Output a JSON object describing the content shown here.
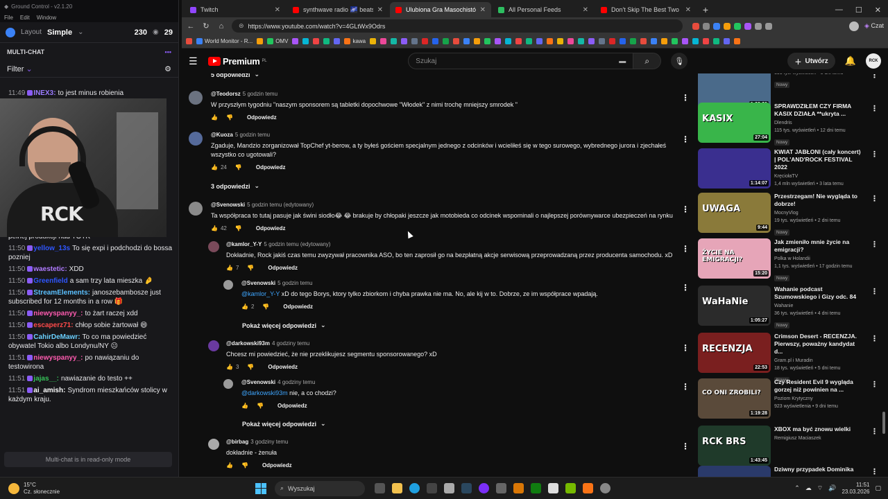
{
  "chat_app": {
    "title": "Ground Control - v2.1.20",
    "menu": [
      "File",
      "Edit",
      "Window"
    ],
    "layout_label": "Layout",
    "layout_value": "Simple",
    "viewers": "230",
    "viewers2": "29",
    "section": "MULTI-CHAT",
    "filter": "Filter",
    "footer": "Multi-chat is in read-only mode",
    "webcam_shirt": "RCK",
    "messages": [
      {
        "time": "11:49",
        "user": "INEX3:",
        "color": "#9b7bff",
        "text": "to jest minus robienia"
      },
      {
        "time": "",
        "user": "",
        "color": "#fff",
        "text": "w open worldy. Już z 4 lata minie od zakończenia pełnej produkcji nad TOTK"
      },
      {
        "time": "11:50",
        "user": "yellow_13s",
        "color": "#2f56ff",
        "text": "To się expi i podchodzi do bossa pozniej"
      },
      {
        "time": "11:50",
        "user": "waestetic:",
        "color": "#b07bff",
        "text": "XDD"
      },
      {
        "time": "11:50",
        "user": "Greenfield",
        "color": "#2f56ff",
        "text": "a sam trzy lata mieszka 🤌"
      },
      {
        "time": "11:50",
        "user": "",
        "color": "#fff",
        "text": "janoszebambosze just subscribed for 12 months in a row 🎁"
      },
      {
        "time": "11:50",
        "user": "StreamElements:",
        "color": "#5bc0ff",
        "text": "janoszebambosze just subscribed for 12 months in a row 🎁"
      },
      {
        "time": "11:50",
        "user": "niewyspanyy_:",
        "color": "#ff5bb0",
        "text": "to żart raczej xdd"
      },
      {
        "time": "11:50",
        "user": "escaperz71:",
        "color": "#ff4a4a",
        "text": "chłop sobie żartował 😄"
      },
      {
        "time": "11:50",
        "user": "CahirDeMawr:",
        "color": "#6ad0ff",
        "text": "To co ma powiedzieć obywatel Tokio albo Londynu/NY 😐"
      },
      {
        "time": "11:51",
        "user": "niewyspanyy_:",
        "color": "#ff5bb0",
        "text": "po nawiązaniu do testowirona"
      },
      {
        "time": "11:51",
        "user": "jajas__:",
        "color": "#37c45a",
        "text": "nawiazanie do testo ++"
      },
      {
        "time": "11:51",
        "user": "ai_amish:",
        "color": "#fff",
        "text": "Syndrom mieszkańców stolicy w każdym kraju."
      }
    ]
  },
  "browser": {
    "tabs": [
      {
        "label": "Twitch",
        "color": "#9146ff"
      },
      {
        "label": "synthwave radio 🌌 beats to",
        "color": "#ff0000"
      },
      {
        "label": "Ulubiona Gra Masochistów - YouTu",
        "color": "#ff0000"
      },
      {
        "label": "All Personal Feeds",
        "color": "#2dbe60"
      },
      {
        "label": "Don't Skip The Best Two Handed W",
        "color": "#ff0000"
      }
    ],
    "url": "https://www.youtube.com/watch?v=4GLtWx9Odrs",
    "profile_label": "Czat",
    "bookmarks": [
      "World Monitor - R...",
      "OMV",
      "kawa"
    ]
  },
  "youtube": {
    "brand": "Premium",
    "brand_sup": "PL",
    "search_placeholder": "Szukaj",
    "create_label": "Utwórz",
    "reply_label": "Odpowiedz",
    "show_more_replies": "Pokaż więcej odpowiedzi",
    "toggles": [
      "5 odpowiedzi",
      "3 odpowiedzi"
    ],
    "comments": [
      {
        "handle": "@Teodorsz",
        "time": "5 godzin temu",
        "text": "W przyszłym tygodniu \"naszym sponsorem są tabletki dopochwowe \"Włodek\" z nimi trochę mniejszy smrodek \"",
        "likes": ""
      },
      {
        "handle": "@Kuoza",
        "time": "5 godzin temu",
        "text": "Zgaduje, Mandzio zorganizował TopChef yt-berow, a ty byłeś gościem specjalnym jednego z odcinków i wcieliłeś się w tego surowego, wybrednego jurora i zjechałeś wszystko co ugotowali?",
        "likes": "24"
      },
      {
        "handle": "@Svenowski",
        "time": "5 godzin temu (edytowany)",
        "text": "Ta współpraca to tutaj pasuje jak świni siodło😂 😂 brakuje by chłopaki jeszcze jak motobieda co odcinek wspominali o najlepszej porównywarce ubezpieczeń na rynku",
        "likes": "42"
      },
      {
        "handle": "@kamlor_Y-Y",
        "time": "5 godzin temu (edytowany)",
        "text": "Dokładnie, Rock jakiś czas temu zwyzywał pracownika ASO, bo ten zaprosił go na bezpłatną akcje serwisową przeprowadzaną przez producenta samochodu. xD",
        "likes": "7"
      },
      {
        "handle": "@Svenowski",
        "time": "5 godzin temu",
        "mention": "@kamlor_Y-Y",
        "text": "xD do tego Borys, ktory tylko zbiorkom i chyba prawka nie ma. No, ale kij w to. Dobrze, ze im współprace wpadają.",
        "likes": "2"
      },
      {
        "handle": "@darkowski93m",
        "time": "4 godziny temu",
        "text": "Chcesz mi powiedzieć, że nie przeklikujesz segmentu sponsorowanego? xD",
        "likes": "3"
      },
      {
        "handle": "@Svenowski",
        "time": "4 godziny temu",
        "mention": "@darkowski93m",
        "text": "nie, a co chodzi?",
        "likes": ""
      },
      {
        "handle": "@birbag",
        "time": "3 godziny temu",
        "text": "dokładnie - żenuła",
        "likes": ""
      }
    ],
    "recommendations": [
      {
        "title": "",
        "channel": "",
        "stats": "193 tys. wyświetleń • 5 dni temu",
        "badge": "Nowy",
        "duration": "1:00:01",
        "thumb": "#4a6a8a",
        "thumb_text": ""
      },
      {
        "title": "SPRAWDZIŁEM CZY FIRMA KASIX DZIAŁA **ukryta ...",
        "channel": "Dlendris",
        "stats": "115 tys. wyświetleń • 12 dni temu",
        "badge": "Nowy",
        "duration": "27:04",
        "thumb": "#39b54a",
        "thumb_text": "KASIX"
      },
      {
        "title": "KWIAT JABŁONI (cały koncert) | POL'AND'ROCK FESTIVAL 2022",
        "channel": "KręciołaTV",
        "stats": "1,4 mln wyświetleń • 3 lata temu",
        "badge": "",
        "duration": "1:14:07",
        "thumb": "#3a2f8f",
        "thumb_text": ""
      },
      {
        "title": "Przestrzegam! Nie wygląda to dobrze!",
        "channel": "MocnyVlog",
        "stats": "19 tys. wyświetleń • 2 dni temu",
        "badge": "Nowy",
        "duration": "9:44",
        "thumb": "#8a7a3a",
        "thumb_text": "UWAGA"
      },
      {
        "title": "Jak zmieniło mnie życie na emigracji?",
        "channel": "Polka w Holandii",
        "stats": "1,1 tys. wyświetleń • 17 godzin temu",
        "badge": "Nowy",
        "duration": "15:20",
        "thumb": "#e6a5b8",
        "thumb_text": "ŻYCIE NA EMIGRACJI?"
      },
      {
        "title": "Wahanie podcast Szumowskiego i Gizy odc. 84",
        "channel": "Wahanie",
        "stats": "36 tys. wyświetleń • 4 dni temu",
        "badge": "Nowy",
        "duration": "1:05:27",
        "thumb": "#2b2b2b",
        "thumb_text": "WaHaNie"
      },
      {
        "title": "Crimson Desert - RECENZJA. Pierwszy, poważny kandydat d...",
        "channel": "Gram.pl i Muradin",
        "stats": "18 tys. wyświetleń • 5 dni temu",
        "badge": "Nowy",
        "duration": "22:53",
        "thumb": "#7a1f1f",
        "thumb_text": "RECENZJA"
      },
      {
        "title": "Czy Resident Evil 9 wygląda gorzej niż powinien na ...",
        "channel": "Poziom Krytyczny",
        "stats": "923 wyświetlenia • 9 dni temu",
        "badge": "",
        "duration": "1:19:28",
        "thumb": "#5a4a3a",
        "thumb_text": "CO ONI ZROBILI?"
      },
      {
        "title": "XBOX ma być znowu wielki",
        "channel": "Remigiusz Maciaszek",
        "stats": "",
        "badge": "",
        "duration": "1:43:45",
        "thumb": "#1f3a2a",
        "thumb_text": "RCK BRS"
      },
      {
        "title": "Dziwny przypadek Dominika",
        "channel": "",
        "stats": "",
        "badge": "",
        "duration": "",
        "thumb": "#2a3a6a",
        "thumb_text": ""
      }
    ]
  },
  "taskbar": {
    "temp": "15°C",
    "weather": "Cz. słonecznie",
    "search": "Wyszukaj",
    "time": "11:51",
    "date": "23.03.2026"
  }
}
